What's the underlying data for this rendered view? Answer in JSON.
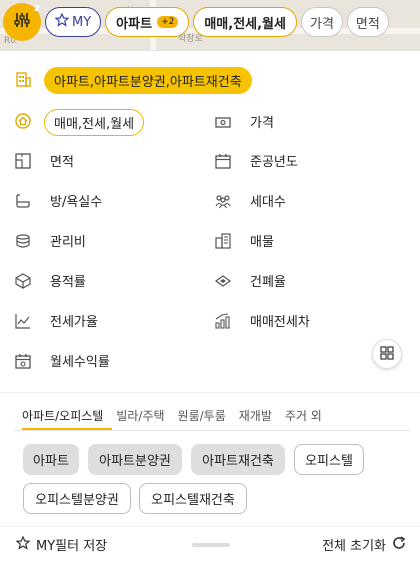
{
  "map": {
    "label_fragment_1": "학",
    "label_fragment_2": "학장로",
    "label_fragment_3": "R0"
  },
  "topbar": {
    "filter_badge": "2",
    "my_label": "MY",
    "type_chip": "아파트",
    "type_chip_extra": "+2",
    "deal_chip": "매매,전세,월세",
    "price_chip": "가격",
    "area_chip": "면적"
  },
  "panel": {
    "property_type": "아파트,아파트분양권,아파트재건축",
    "deal_type": "매매,전세,월세",
    "filters": {
      "price": "가격",
      "area": "면적",
      "year_built": "준공년도",
      "rooms": "방/욕실수",
      "households": "세대수",
      "maintenance": "관리비",
      "listings": "매물",
      "floor_area_ratio": "용적률",
      "building_coverage": "건폐율",
      "jeonse_rate": "전세가율",
      "price_gap": "매매전세차",
      "rent_yield": "월세수익률"
    }
  },
  "tabs": [
    "아파트/오피스텔",
    "빌라/주택",
    "원룸/투룸",
    "재개발",
    "주거 외"
  ],
  "options": {
    "apt": "아파트",
    "apt_presale": "아파트분양권",
    "apt_rebuild": "아파트재건축",
    "officetel": "오피스텔",
    "officetel_presale": "오피스텔분양권",
    "officetel_rebuild": "오피스텔재건축"
  },
  "footer": {
    "save": "MY필터 저장",
    "reset": "전체 초기화"
  },
  "colors": {
    "accent": "#f4b400",
    "my": "#3b3fa6"
  }
}
